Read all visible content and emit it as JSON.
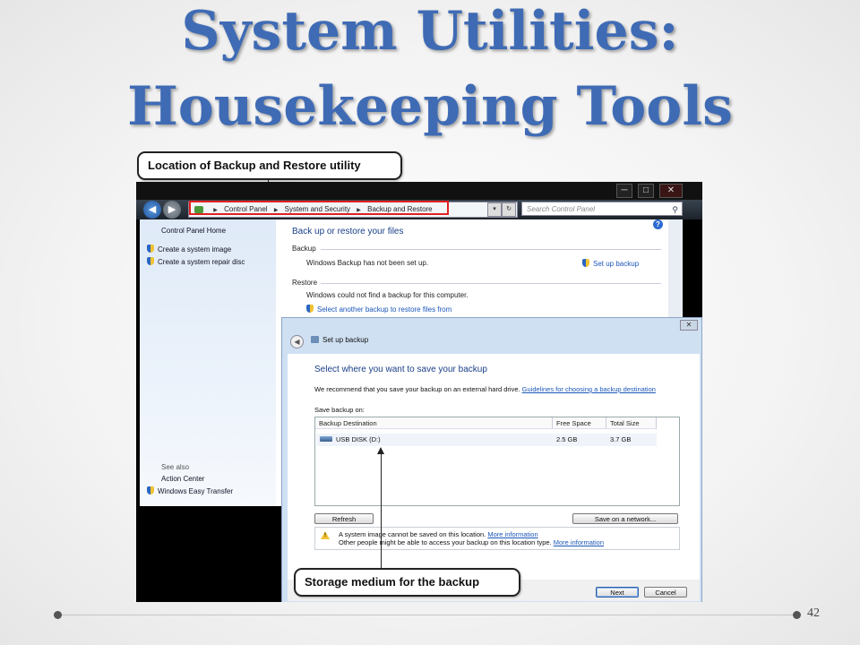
{
  "slide": {
    "title_line1": "System Utilities:",
    "title_line2": "Housekeeping Tools",
    "page_number": "42"
  },
  "callouts": {
    "top": "Location of Backup and Restore utility",
    "bottom": "Storage medium for the backup"
  },
  "explorer": {
    "breadcrumb": [
      "Control Panel",
      "System and Security",
      "Backup and Restore"
    ],
    "search_placeholder": "Search Control Panel",
    "window_buttons": [
      "─",
      "□",
      "✕"
    ]
  },
  "sidebar": {
    "home": "Control Panel Home",
    "items": [
      "Create a system image",
      "Create a system repair disc"
    ],
    "see_also_heading": "See also",
    "see_also": [
      "Action Center",
      "Windows Easy Transfer"
    ]
  },
  "main": {
    "heading": "Back up or restore your files",
    "backup_section": "Backup",
    "backup_status": "Windows Backup has not been set up.",
    "setup_link": "Set up backup",
    "restore_section": "Restore",
    "restore_status": "Windows could not find a backup for this computer.",
    "restore_link": "Select another backup to restore files from"
  },
  "dialog": {
    "title": "Set up backup",
    "heading": "Select where you want to save your backup",
    "recommend_text": "We recommend that you save your backup on an external hard drive. ",
    "guidelines_link": "Guidelines for choosing a backup destination",
    "save_on_label": "Save backup on:",
    "columns": [
      "Backup Destination",
      "Free Space",
      "Total Size"
    ],
    "rows": [
      {
        "destination": "USB DISK (D:)",
        "free": "2.5 GB",
        "total": "3.7 GB"
      }
    ],
    "refresh_button": "Refresh",
    "network_button": "Save on a network...",
    "warning_line1": "A system image cannot be saved on this location. ",
    "warning_line2": "Other people might be able to access your backup on this location type. ",
    "more_info": "More information",
    "next_button": "Next",
    "cancel_button": "Cancel"
  }
}
